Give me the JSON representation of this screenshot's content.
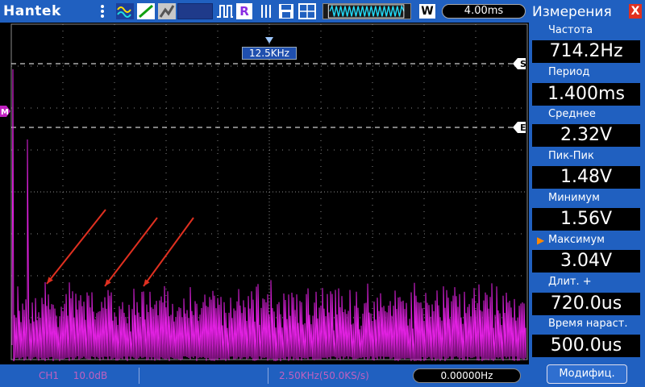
{
  "topbar": {
    "brand": "Hantek",
    "run_mode_badge": "R",
    "timebase_mode_badge": "W",
    "timebase": "4.00ms"
  },
  "plot": {
    "center_frequency_label": "12.5KHz",
    "markers": {
      "s": "S",
      "e": "E",
      "m": "M"
    },
    "colors": {
      "trace": "#e020e0",
      "grid": "#8a8a8a",
      "annotation_arrow": "#e03020"
    }
  },
  "bottombar": {
    "channel": "CH1",
    "scale": "10.0dB",
    "span_rate": "2.50KHz(50.0KS/s)",
    "frequency": "0.00000Hz"
  },
  "measurements": {
    "title": "Измерения",
    "close_label": "X",
    "items": [
      {
        "label": "Частота",
        "value": "714.2Hz",
        "selected": false
      },
      {
        "label": "Период",
        "value": "1.400ms",
        "selected": false
      },
      {
        "label": "Среднее",
        "value": "2.32V",
        "selected": false
      },
      {
        "label": "Пик-Пик",
        "value": "1.48V",
        "selected": false
      },
      {
        "label": "Минимум",
        "value": "1.56V",
        "selected": false
      },
      {
        "label": "Максимум",
        "value": "3.04V",
        "selected": true
      },
      {
        "label": "Длит.  +",
        "value": "720.0us",
        "selected": false
      },
      {
        "label": "Время  нараст.",
        "value": "500.0us",
        "selected": false
      }
    ],
    "modify_button": "Модифиц."
  },
  "colors": {
    "bar_blue": "#2060c0",
    "accent_orange": "#ff8800",
    "close_red": "#e03020"
  }
}
